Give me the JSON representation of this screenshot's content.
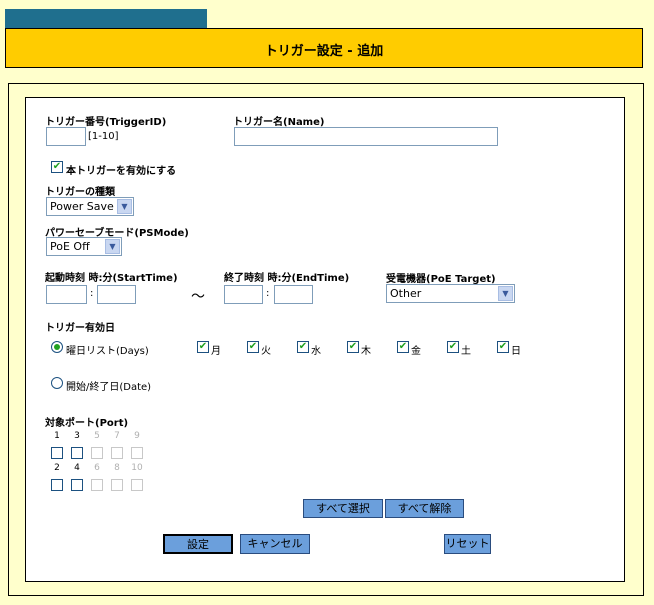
{
  "header": {
    "title": "トリガー設定 - 追加"
  },
  "trigger_id": {
    "label": "トリガー番号(TriggerID)",
    "value": "",
    "range": "[1-10]"
  },
  "trigger_name": {
    "label": "トリガー名(Name)",
    "value": ""
  },
  "enable": {
    "label": "本トリガーを有効にする",
    "checked": true
  },
  "trigger_type": {
    "label": "トリガーの種類",
    "selected": "Power Save"
  },
  "ps_mode": {
    "label": "パワーセーブモード(PSMode)",
    "selected": "PoE Off"
  },
  "start_time": {
    "label": "起動時刻 時:分(StartTime)",
    "hour": "",
    "minute": "",
    "sep": ":"
  },
  "tilde": "～",
  "end_time": {
    "label": "終了時刻 時:分(EndTime)",
    "hour": "",
    "minute": "",
    "sep": ":"
  },
  "poe_target": {
    "label": "受電機器(PoE Target)",
    "selected": "Other"
  },
  "days_section": {
    "label": "トリガー有効日",
    "days_option": "曜日リスト(Days)",
    "date_option": "開始/終了日(Date)",
    "days": [
      {
        "label": "月",
        "checked": true
      },
      {
        "label": "火",
        "checked": true
      },
      {
        "label": "水",
        "checked": true
      },
      {
        "label": "木",
        "checked": true
      },
      {
        "label": "金",
        "checked": true
      },
      {
        "label": "土",
        "checked": true
      },
      {
        "label": "日",
        "checked": true
      }
    ]
  },
  "ports": {
    "label": "対象ポート(Port)",
    "top": [
      {
        "n": "1",
        "enabled": true
      },
      {
        "n": "3",
        "enabled": true
      },
      {
        "n": "5",
        "enabled": false
      },
      {
        "n": "7",
        "enabled": false
      },
      {
        "n": "9",
        "enabled": false
      }
    ],
    "bottom": [
      {
        "n": "2",
        "enabled": true
      },
      {
        "n": "4",
        "enabled": true
      },
      {
        "n": "6",
        "enabled": false
      },
      {
        "n": "8",
        "enabled": false
      },
      {
        "n": "10",
        "enabled": false
      }
    ]
  },
  "buttons": {
    "select_all": "すべて選択",
    "clear_all": "すべて解除",
    "set": "設定",
    "cancel": "キャンセル",
    "reset": "リセット"
  },
  "colors": {
    "header": "#ffcc00",
    "tab": "#1f6f8e",
    "button": "#6b9fdc",
    "check": "#21a121"
  }
}
